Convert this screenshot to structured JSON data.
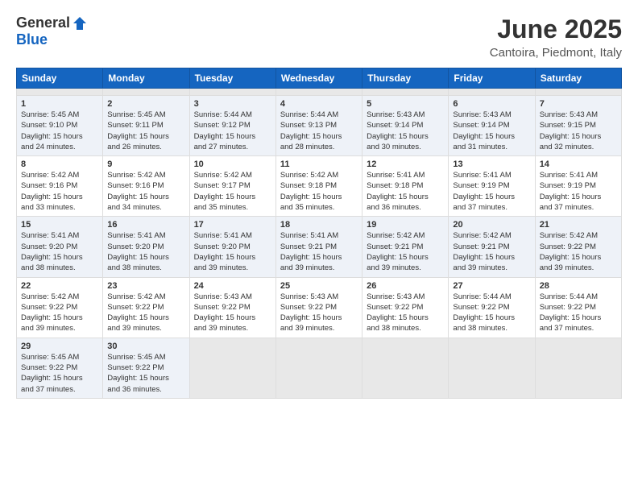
{
  "header": {
    "logo_general": "General",
    "logo_blue": "Blue",
    "main_title": "June 2025",
    "subtitle": "Cantoira, Piedmont, Italy"
  },
  "calendar": {
    "days_of_week": [
      "Sunday",
      "Monday",
      "Tuesday",
      "Wednesday",
      "Thursday",
      "Friday",
      "Saturday"
    ],
    "weeks": [
      [
        {
          "day": "",
          "empty": true
        },
        {
          "day": "",
          "empty": true
        },
        {
          "day": "",
          "empty": true
        },
        {
          "day": "",
          "empty": true
        },
        {
          "day": "",
          "empty": true
        },
        {
          "day": "",
          "empty": true
        },
        {
          "day": "",
          "empty": true
        }
      ],
      [
        {
          "day": "1",
          "lines": [
            "Sunrise: 5:45 AM",
            "Sunset: 9:10 PM",
            "Daylight: 15 hours",
            "and 24 minutes."
          ]
        },
        {
          "day": "2",
          "lines": [
            "Sunrise: 5:45 AM",
            "Sunset: 9:11 PM",
            "Daylight: 15 hours",
            "and 26 minutes."
          ]
        },
        {
          "day": "3",
          "lines": [
            "Sunrise: 5:44 AM",
            "Sunset: 9:12 PM",
            "Daylight: 15 hours",
            "and 27 minutes."
          ]
        },
        {
          "day": "4",
          "lines": [
            "Sunrise: 5:44 AM",
            "Sunset: 9:13 PM",
            "Daylight: 15 hours",
            "and 28 minutes."
          ]
        },
        {
          "day": "5",
          "lines": [
            "Sunrise: 5:43 AM",
            "Sunset: 9:14 PM",
            "Daylight: 15 hours",
            "and 30 minutes."
          ]
        },
        {
          "day": "6",
          "lines": [
            "Sunrise: 5:43 AM",
            "Sunset: 9:14 PM",
            "Daylight: 15 hours",
            "and 31 minutes."
          ]
        },
        {
          "day": "7",
          "lines": [
            "Sunrise: 5:43 AM",
            "Sunset: 9:15 PM",
            "Daylight: 15 hours",
            "and 32 minutes."
          ]
        }
      ],
      [
        {
          "day": "8",
          "lines": [
            "Sunrise: 5:42 AM",
            "Sunset: 9:16 PM",
            "Daylight: 15 hours",
            "and 33 minutes."
          ]
        },
        {
          "day": "9",
          "lines": [
            "Sunrise: 5:42 AM",
            "Sunset: 9:16 PM",
            "Daylight: 15 hours",
            "and 34 minutes."
          ]
        },
        {
          "day": "10",
          "lines": [
            "Sunrise: 5:42 AM",
            "Sunset: 9:17 PM",
            "Daylight: 15 hours",
            "and 35 minutes."
          ]
        },
        {
          "day": "11",
          "lines": [
            "Sunrise: 5:42 AM",
            "Sunset: 9:18 PM",
            "Daylight: 15 hours",
            "and 35 minutes."
          ]
        },
        {
          "day": "12",
          "lines": [
            "Sunrise: 5:41 AM",
            "Sunset: 9:18 PM",
            "Daylight: 15 hours",
            "and 36 minutes."
          ]
        },
        {
          "day": "13",
          "lines": [
            "Sunrise: 5:41 AM",
            "Sunset: 9:19 PM",
            "Daylight: 15 hours",
            "and 37 minutes."
          ]
        },
        {
          "day": "14",
          "lines": [
            "Sunrise: 5:41 AM",
            "Sunset: 9:19 PM",
            "Daylight: 15 hours",
            "and 37 minutes."
          ]
        }
      ],
      [
        {
          "day": "15",
          "lines": [
            "Sunrise: 5:41 AM",
            "Sunset: 9:20 PM",
            "Daylight: 15 hours",
            "and 38 minutes."
          ]
        },
        {
          "day": "16",
          "lines": [
            "Sunrise: 5:41 AM",
            "Sunset: 9:20 PM",
            "Daylight: 15 hours",
            "and 38 minutes."
          ]
        },
        {
          "day": "17",
          "lines": [
            "Sunrise: 5:41 AM",
            "Sunset: 9:20 PM",
            "Daylight: 15 hours",
            "and 39 minutes."
          ]
        },
        {
          "day": "18",
          "lines": [
            "Sunrise: 5:41 AM",
            "Sunset: 9:21 PM",
            "Daylight: 15 hours",
            "and 39 minutes."
          ]
        },
        {
          "day": "19",
          "lines": [
            "Sunrise: 5:42 AM",
            "Sunset: 9:21 PM",
            "Daylight: 15 hours",
            "and 39 minutes."
          ]
        },
        {
          "day": "20",
          "lines": [
            "Sunrise: 5:42 AM",
            "Sunset: 9:21 PM",
            "Daylight: 15 hours",
            "and 39 minutes."
          ]
        },
        {
          "day": "21",
          "lines": [
            "Sunrise: 5:42 AM",
            "Sunset: 9:22 PM",
            "Daylight: 15 hours",
            "and 39 minutes."
          ]
        }
      ],
      [
        {
          "day": "22",
          "lines": [
            "Sunrise: 5:42 AM",
            "Sunset: 9:22 PM",
            "Daylight: 15 hours",
            "and 39 minutes."
          ]
        },
        {
          "day": "23",
          "lines": [
            "Sunrise: 5:42 AM",
            "Sunset: 9:22 PM",
            "Daylight: 15 hours",
            "and 39 minutes."
          ]
        },
        {
          "day": "24",
          "lines": [
            "Sunrise: 5:43 AM",
            "Sunset: 9:22 PM",
            "Daylight: 15 hours",
            "and 39 minutes."
          ]
        },
        {
          "day": "25",
          "lines": [
            "Sunrise: 5:43 AM",
            "Sunset: 9:22 PM",
            "Daylight: 15 hours",
            "and 39 minutes."
          ]
        },
        {
          "day": "26",
          "lines": [
            "Sunrise: 5:43 AM",
            "Sunset: 9:22 PM",
            "Daylight: 15 hours",
            "and 38 minutes."
          ]
        },
        {
          "day": "27",
          "lines": [
            "Sunrise: 5:44 AM",
            "Sunset: 9:22 PM",
            "Daylight: 15 hours",
            "and 38 minutes."
          ]
        },
        {
          "day": "28",
          "lines": [
            "Sunrise: 5:44 AM",
            "Sunset: 9:22 PM",
            "Daylight: 15 hours",
            "and 37 minutes."
          ]
        }
      ],
      [
        {
          "day": "29",
          "lines": [
            "Sunrise: 5:45 AM",
            "Sunset: 9:22 PM",
            "Daylight: 15 hours",
            "and 37 minutes."
          ]
        },
        {
          "day": "30",
          "lines": [
            "Sunrise: 5:45 AM",
            "Sunset: 9:22 PM",
            "Daylight: 15 hours",
            "and 36 minutes."
          ]
        },
        {
          "day": "",
          "empty": true
        },
        {
          "day": "",
          "empty": true
        },
        {
          "day": "",
          "empty": true
        },
        {
          "day": "",
          "empty": true
        },
        {
          "day": "",
          "empty": true
        }
      ]
    ]
  }
}
